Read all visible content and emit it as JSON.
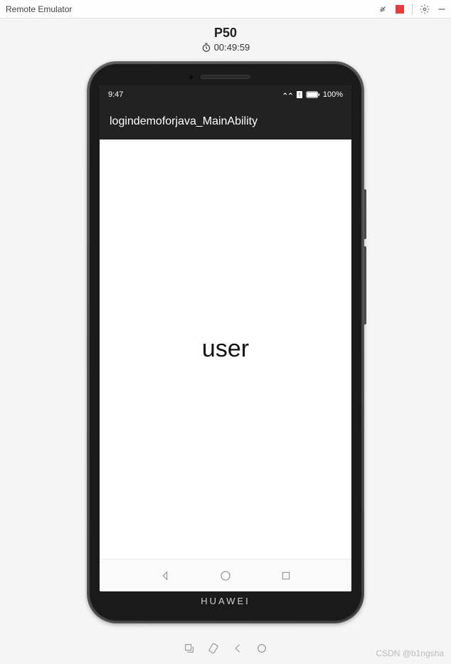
{
  "window": {
    "title": "Remote Emulator"
  },
  "header": {
    "device_name": "P50",
    "timer": "00:49:59"
  },
  "phone": {
    "brand": "HUAWEI",
    "status_bar": {
      "time": "9:47",
      "battery": "100%"
    },
    "app_bar": {
      "title": "logindemoforjava_MainAbility"
    },
    "content": {
      "text": "user"
    }
  },
  "watermark": "CSDN @b1ngsha"
}
